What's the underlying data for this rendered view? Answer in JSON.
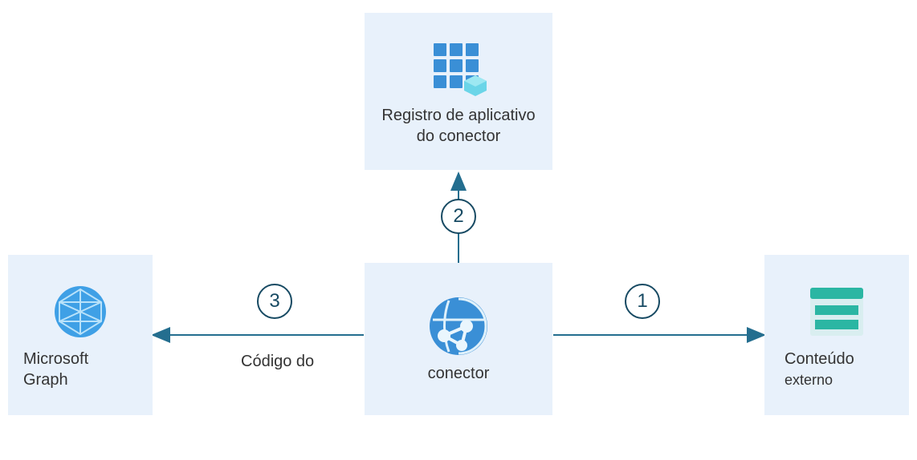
{
  "nodes": {
    "top": {
      "label": "Registro de aplicativo do conector"
    },
    "left": {
      "label_line1": "Microsoft",
      "label_line2": "Graph"
    },
    "center": {
      "label": "conector"
    },
    "right": {
      "label_line1": "Conteúdo",
      "label_line2": "externo"
    }
  },
  "arrows": {
    "to_left_label": "Código do",
    "badge1": "1",
    "badge2": "2",
    "badge3": "3"
  },
  "colors": {
    "node_bg": "#e8f1fb",
    "arrow": "#246e8f",
    "badge_border": "#174a63"
  }
}
